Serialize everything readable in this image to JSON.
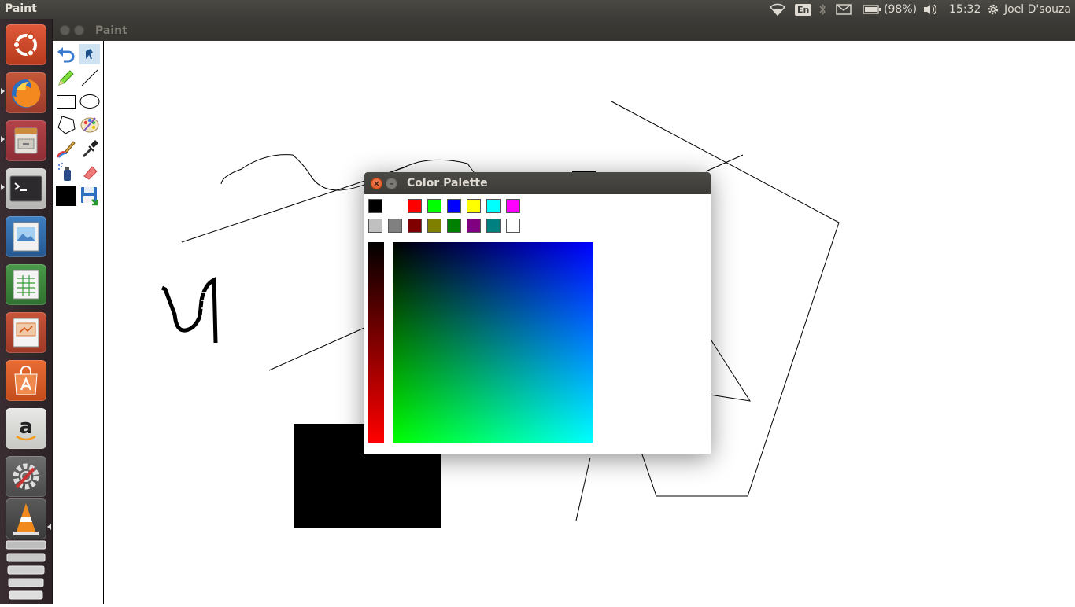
{
  "top_panel": {
    "app_name": "Paint",
    "keyboard_layout": "En",
    "battery": "(98%)",
    "time": "15:32",
    "user": "Joel D'souza"
  },
  "launcher": {
    "items": [
      {
        "name": "ubuntu-dash",
        "icon": "ubuntu-logo-icon"
      },
      {
        "name": "firefox",
        "icon": "firefox-icon"
      },
      {
        "name": "files",
        "icon": "file-cabinet-icon"
      },
      {
        "name": "terminal",
        "icon": "terminal-icon"
      },
      {
        "name": "image-viewer",
        "icon": "image-viewer-icon"
      },
      {
        "name": "libreoffice-calc",
        "icon": "spreadsheet-icon"
      },
      {
        "name": "libreoffice-impress",
        "icon": "presentation-icon"
      },
      {
        "name": "software-center",
        "icon": "shopping-bag-icon"
      },
      {
        "name": "amazon",
        "icon": "amazon-icon"
      },
      {
        "name": "system-settings",
        "icon": "settings-gear-icon"
      },
      {
        "name": "vlc",
        "icon": "traffic-cone-icon"
      }
    ]
  },
  "paint_window": {
    "title": "Paint",
    "tools": [
      "undo",
      "fill",
      "pencil",
      "line",
      "rectangle",
      "ellipse",
      "polygon",
      "color-palette",
      "brush",
      "eyedropper",
      "spray",
      "eraser",
      "current-color",
      "save"
    ],
    "current_color": "#000000"
  },
  "palette_dialog": {
    "title": "Color Palette",
    "swatches_row1": [
      "#000000",
      "#ffffff",
      "#ff0000",
      "#00ff00",
      "#0000ff",
      "#ffff00",
      "#00ffff",
      "#ff00ff"
    ],
    "swatches_row2": [
      "#c0c0c0",
      "#808080",
      "#800000",
      "#808000",
      "#008000",
      "#800080",
      "#008080",
      "#ffffff"
    ],
    "slider_color": "#ff0000",
    "accent_close": "#dd4814"
  }
}
